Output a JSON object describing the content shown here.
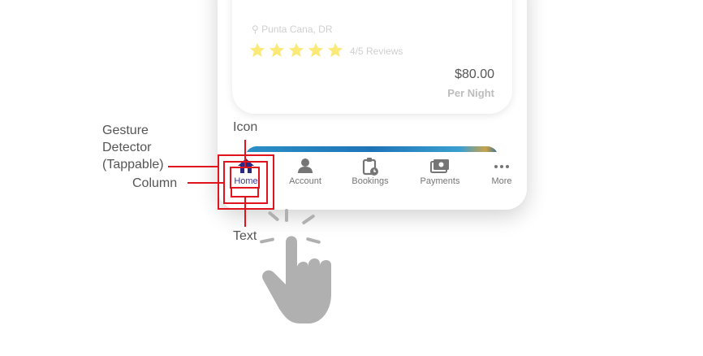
{
  "listing": {
    "location": "Punta Cana, DR",
    "rating_stars": 5,
    "reviews": "4/5 Reviews",
    "price": "$80.00",
    "price_unit": "Per Night"
  },
  "nav": {
    "items": [
      {
        "label": "Home",
        "icon": "home-icon",
        "active": true
      },
      {
        "label": "Account",
        "icon": "person-icon",
        "active": false
      },
      {
        "label": "Bookings",
        "icon": "clipboard-clock-icon",
        "active": false
      },
      {
        "label": "Payments",
        "icon": "cash-icon",
        "active": false
      },
      {
        "label": "More",
        "icon": "more-dots-icon",
        "active": false
      }
    ]
  },
  "annotations": {
    "gesture_line1": "Gesture",
    "gesture_line2": "Detector",
    "gesture_line3": "(Tappable)",
    "column": "Column",
    "icon": "Icon",
    "text": "Text"
  },
  "colors": {
    "accent": "#3a3a8c",
    "annotation": "#e0141c",
    "star": "#fbe97a",
    "hand": "#b0b0b0"
  }
}
